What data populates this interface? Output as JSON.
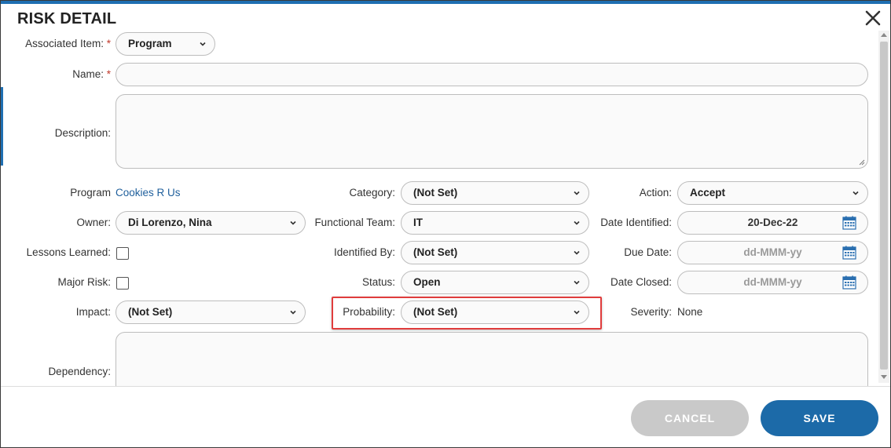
{
  "dialog": {
    "title": "RISK DETAIL"
  },
  "fields": {
    "associated_item": {
      "label": "Associated Item:",
      "required_mark": "*",
      "value": "Program"
    },
    "name": {
      "label": "Name:",
      "required_mark": "*",
      "value": ""
    },
    "description": {
      "label": "Description:",
      "value": ""
    },
    "program": {
      "label": "Program",
      "value": "Cookies R Us"
    },
    "owner": {
      "label": "Owner:",
      "value": "Di Lorenzo, Nina"
    },
    "lessons_learned": {
      "label": "Lessons Learned:",
      "checked": false
    },
    "major_risk": {
      "label": "Major Risk:",
      "checked": false
    },
    "impact": {
      "label": "Impact:",
      "value": "(Not Set)"
    },
    "category": {
      "label": "Category:",
      "value": "(Not Set)"
    },
    "functional_team": {
      "label": "Functional Team:",
      "value": "IT"
    },
    "identified_by": {
      "label": "Identified By:",
      "value": "(Not Set)"
    },
    "status": {
      "label": "Status:",
      "value": "Open"
    },
    "probability": {
      "label": "Probability:",
      "value": "(Not Set)"
    },
    "action": {
      "label": "Action:",
      "value": "Accept"
    },
    "date_identified": {
      "label": "Date Identified:",
      "value": "20-Dec-22"
    },
    "due_date": {
      "label": "Due Date:",
      "placeholder": "dd-MMM-yy"
    },
    "date_closed": {
      "label": "Date Closed:",
      "placeholder": "dd-MMM-yy"
    },
    "severity": {
      "label": "Severity:",
      "value": "None"
    },
    "dependency": {
      "label": "Dependency:",
      "value": ""
    }
  },
  "buttons": {
    "cancel": "CANCEL",
    "save": "SAVE"
  },
  "colors": {
    "accent": "#1c6aa8",
    "highlight": "#e03c3c",
    "link": "#1f5f9c",
    "required": "#c0392b"
  },
  "icons": {
    "close": "close-icon",
    "calendar": "calendar-icon",
    "chevron": "chevron-down-icon"
  }
}
